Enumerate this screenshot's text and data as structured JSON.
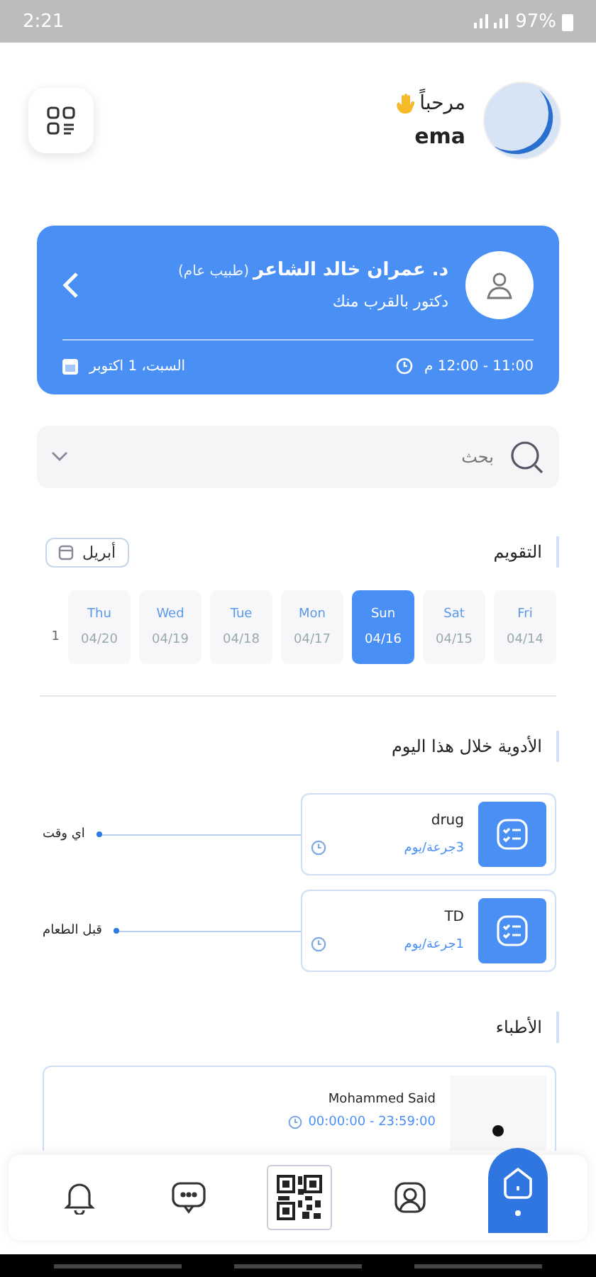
{
  "status_bar": {
    "time": "2:21",
    "battery": "97%"
  },
  "header": {
    "greeting": "مرحباً",
    "name": "ema"
  },
  "appointment": {
    "doctor": "د. عمران خالد الشاعر",
    "specialty": "(طبيب عام)",
    "subtitle": "دكتور بالقرب منك",
    "time": "11:00 - 12:00 م",
    "date": "السبت، 1 اكتوبر"
  },
  "search": {
    "placeholder": "بحث"
  },
  "calendar": {
    "title": "التقويم",
    "month": "أبريل",
    "days": [
      {
        "kind": "day",
        "day": "Fri",
        "date": "04/14",
        "selected": false
      },
      {
        "kind": "day",
        "day": "Sat",
        "date": "04/15",
        "selected": false
      },
      {
        "kind": "day",
        "day": "Sun",
        "date": "04/16",
        "selected": true
      },
      {
        "kind": "day",
        "day": "Mon",
        "date": "04/17",
        "selected": false
      },
      {
        "kind": "day",
        "day": "Tue",
        "date": "04/18",
        "selected": false
      },
      {
        "kind": "day",
        "day": "Wed",
        "date": "04/19",
        "selected": false
      },
      {
        "kind": "day",
        "day": "Thu",
        "date": "04/20",
        "selected": false
      },
      {
        "kind": "partial",
        "date": "1"
      }
    ]
  },
  "medications": {
    "title": "الأدوية خلال هذا اليوم",
    "items": [
      {
        "name": "drug",
        "dose": "3جرعة/يوم",
        "timing": "اي وقت"
      },
      {
        "name": "TD",
        "dose": "1جرعة/يوم",
        "timing": "قبل الطعام"
      }
    ]
  },
  "doctors": {
    "title": "الأطباء",
    "items": [
      {
        "name": "Mohammed Said",
        "hours": "00:00:00 - 23:59:00"
      }
    ]
  },
  "nav": [
    {
      "kind": "bell",
      "selected": false
    },
    {
      "kind": "chat",
      "selected": false
    },
    {
      "kind": "qr",
      "selected": false
    },
    {
      "kind": "profile",
      "selected": false
    },
    {
      "kind": "home",
      "selected": true
    }
  ]
}
